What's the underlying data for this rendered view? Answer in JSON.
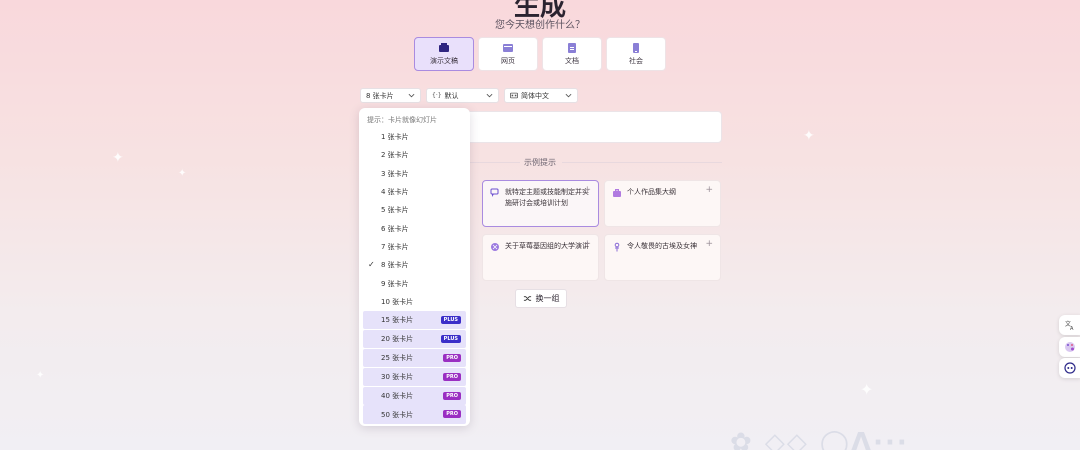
{
  "header": {
    "title": "生成",
    "subtitle": "您今天想创作什么？"
  },
  "types": [
    {
      "label": "演示文稿",
      "icon": "presentation-icon"
    },
    {
      "label": "网页",
      "icon": "webpage-icon"
    },
    {
      "label": "文档",
      "icon": "document-icon"
    },
    {
      "label": "社会",
      "icon": "social-icon"
    }
  ],
  "options": {
    "cards_value": "8 张卡片",
    "theme_icon": "{·}",
    "theme_value": "默认",
    "language_icon": "language-icon",
    "language_value": "简体中文"
  },
  "examples": {
    "label": "示例提示",
    "cards": [
      {
        "text": "就特定主题或技能制定并实施研讨会或培训计划",
        "icon": "chat-icon"
      },
      {
        "text": "个人作品集大纲",
        "icon": "briefcase-icon"
      },
      {
        "text": "关于草莓基因组的大学演讲",
        "icon": "dna-icon"
      },
      {
        "text": "令人敬畏的古埃及女神",
        "icon": "ankh-icon"
      }
    ],
    "shuffle_label": "换一组"
  },
  "dropdown": {
    "hint": "提示：卡片就像幻灯片",
    "selected": "8 张卡片",
    "items": [
      {
        "label": "1 张卡片",
        "badge": ""
      },
      {
        "label": "2 张卡片",
        "badge": ""
      },
      {
        "label": "3 张卡片",
        "badge": ""
      },
      {
        "label": "4 张卡片",
        "badge": ""
      },
      {
        "label": "5 张卡片",
        "badge": ""
      },
      {
        "label": "6 张卡片",
        "badge": ""
      },
      {
        "label": "7 张卡片",
        "badge": ""
      },
      {
        "label": "8 张卡片",
        "badge": ""
      },
      {
        "label": "9 张卡片",
        "badge": ""
      },
      {
        "label": "10 张卡片",
        "badge": ""
      },
      {
        "label": "15 张卡片",
        "badge": "PLUS"
      },
      {
        "label": "20 张卡片",
        "badge": "PLUS"
      },
      {
        "label": "25 张卡片",
        "badge": "PRO"
      },
      {
        "label": "30 张卡片",
        "badge": "PRO"
      },
      {
        "label": "40 张卡片",
        "badge": "PRO"
      },
      {
        "label": "50 张卡片",
        "badge": "PRO"
      }
    ]
  },
  "side": [
    {
      "icon": "translate-icon"
    },
    {
      "icon": "palette-icon"
    },
    {
      "icon": "chatbot-icon"
    }
  ],
  "colors": {
    "accent": "#a98be0",
    "plus_badge": "#3b2ec9",
    "pro_badge": "#9a2fc2",
    "paid_row": "#e6e2fa"
  }
}
